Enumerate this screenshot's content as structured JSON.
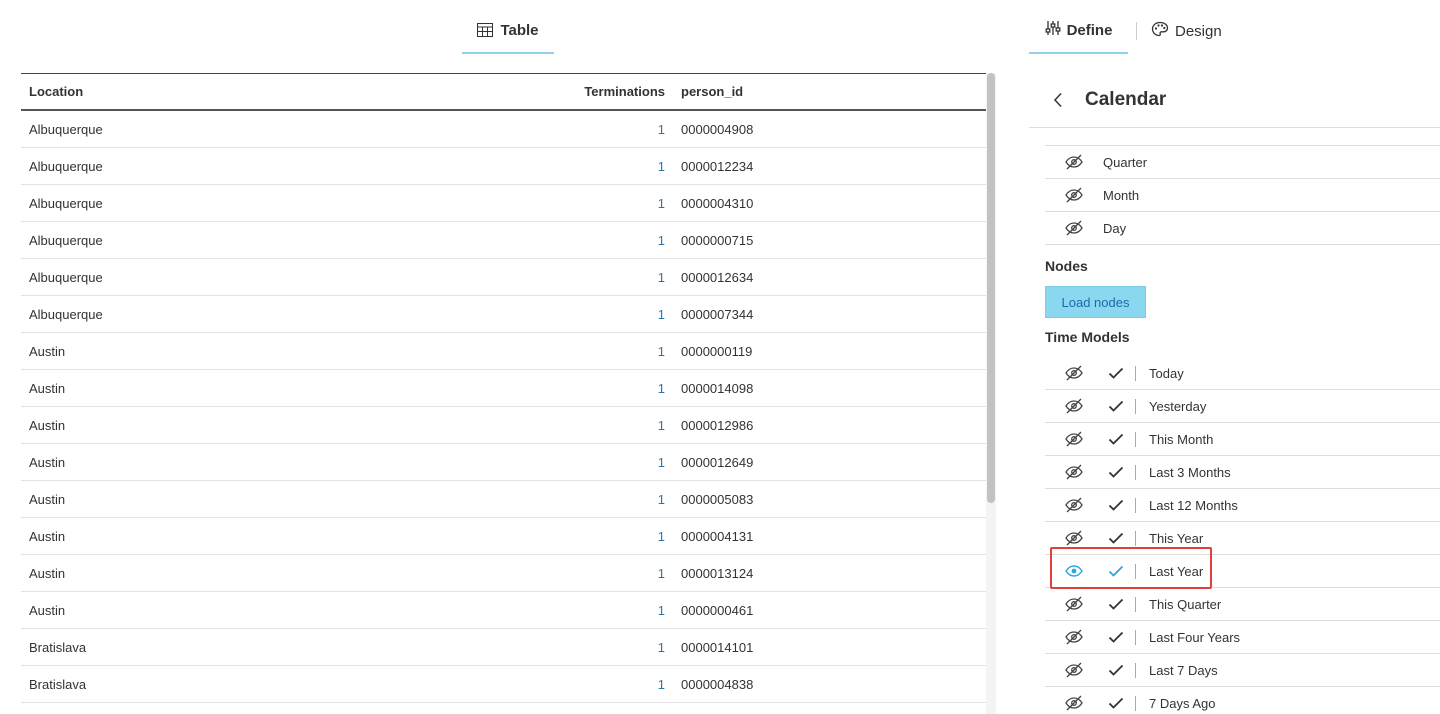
{
  "left_tab": {
    "label": "Table",
    "icon": "table-icon"
  },
  "table": {
    "headers": [
      "Location",
      "Terminations",
      "person_id"
    ],
    "rows": [
      [
        "Albuquerque",
        "1",
        "0000004908"
      ],
      [
        "Albuquerque",
        "1",
        "0000012234"
      ],
      [
        "Albuquerque",
        "1",
        "0000004310"
      ],
      [
        "Albuquerque",
        "1",
        "0000000715"
      ],
      [
        "Albuquerque",
        "1",
        "0000012634"
      ],
      [
        "Albuquerque",
        "1",
        "0000007344"
      ],
      [
        "Austin",
        "1",
        "0000000119"
      ],
      [
        "Austin",
        "1",
        "0000014098"
      ],
      [
        "Austin",
        "1",
        "0000012986"
      ],
      [
        "Austin",
        "1",
        "0000012649"
      ],
      [
        "Austin",
        "1",
        "0000005083"
      ],
      [
        "Austin",
        "1",
        "0000004131"
      ],
      [
        "Austin",
        "1",
        "0000013124"
      ],
      [
        "Austin",
        "1",
        "0000000461"
      ],
      [
        "Bratislava",
        "1",
        "0000014101"
      ],
      [
        "Bratislava",
        "1",
        "0000004838"
      ]
    ]
  },
  "right_tabs": {
    "define": {
      "label": "Define",
      "icon": "sliders-icon"
    },
    "design": {
      "label": "Design",
      "icon": "palette-icon"
    }
  },
  "calendar": {
    "title": "Calendar",
    "levels": [
      {
        "label": "Quarter",
        "visible": false
      },
      {
        "label": "Month",
        "visible": false
      },
      {
        "label": "Day",
        "visible": false
      }
    ],
    "nodes_label": "Nodes",
    "load_nodes_label": "Load nodes",
    "time_models_label": "Time Models",
    "time_models": [
      {
        "label": "Today",
        "visible": false,
        "active": false
      },
      {
        "label": "Yesterday",
        "visible": false,
        "active": false
      },
      {
        "label": "This Month",
        "visible": false,
        "active": false
      },
      {
        "label": "Last 3 Months",
        "visible": false,
        "active": false
      },
      {
        "label": "Last 12 Months",
        "visible": false,
        "active": false
      },
      {
        "label": "This Year",
        "visible": false,
        "active": false
      },
      {
        "label": "Last Year",
        "visible": true,
        "active": true
      },
      {
        "label": "This Quarter",
        "visible": false,
        "active": false
      },
      {
        "label": "Last Four Years",
        "visible": false,
        "active": false
      },
      {
        "label": "Last 7 Days",
        "visible": false,
        "active": false
      },
      {
        "label": "7 Days Ago",
        "visible": false,
        "active": false
      }
    ]
  },
  "colors": {
    "accent": "#8fd3ea",
    "link_blue": "#2b78a8",
    "active_blue": "#2aa7e0",
    "highlight_red": "#e0413b"
  }
}
